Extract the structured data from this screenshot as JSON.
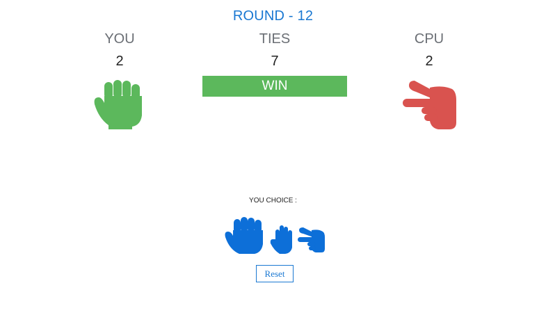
{
  "round_label": "ROUND - 12",
  "players": {
    "you": {
      "label": "YOU",
      "score": "2",
      "hand": "rock-icon"
    },
    "ties": {
      "label": "TIES",
      "score": "7"
    },
    "cpu": {
      "label": "CPU",
      "score": "2",
      "hand": "scissors-icon"
    }
  },
  "result": {
    "text": "WIN",
    "color": "#5cb85c"
  },
  "choices": {
    "label": "YOU CHOICE :",
    "items": [
      "rock-icon",
      "paper-icon",
      "scissors-icon"
    ],
    "color": "#0d6fd8"
  },
  "reset_label": "Reset",
  "colors": {
    "you": "#5cb85c",
    "cpu": "#d9534f",
    "accent": "#1a78d2"
  }
}
